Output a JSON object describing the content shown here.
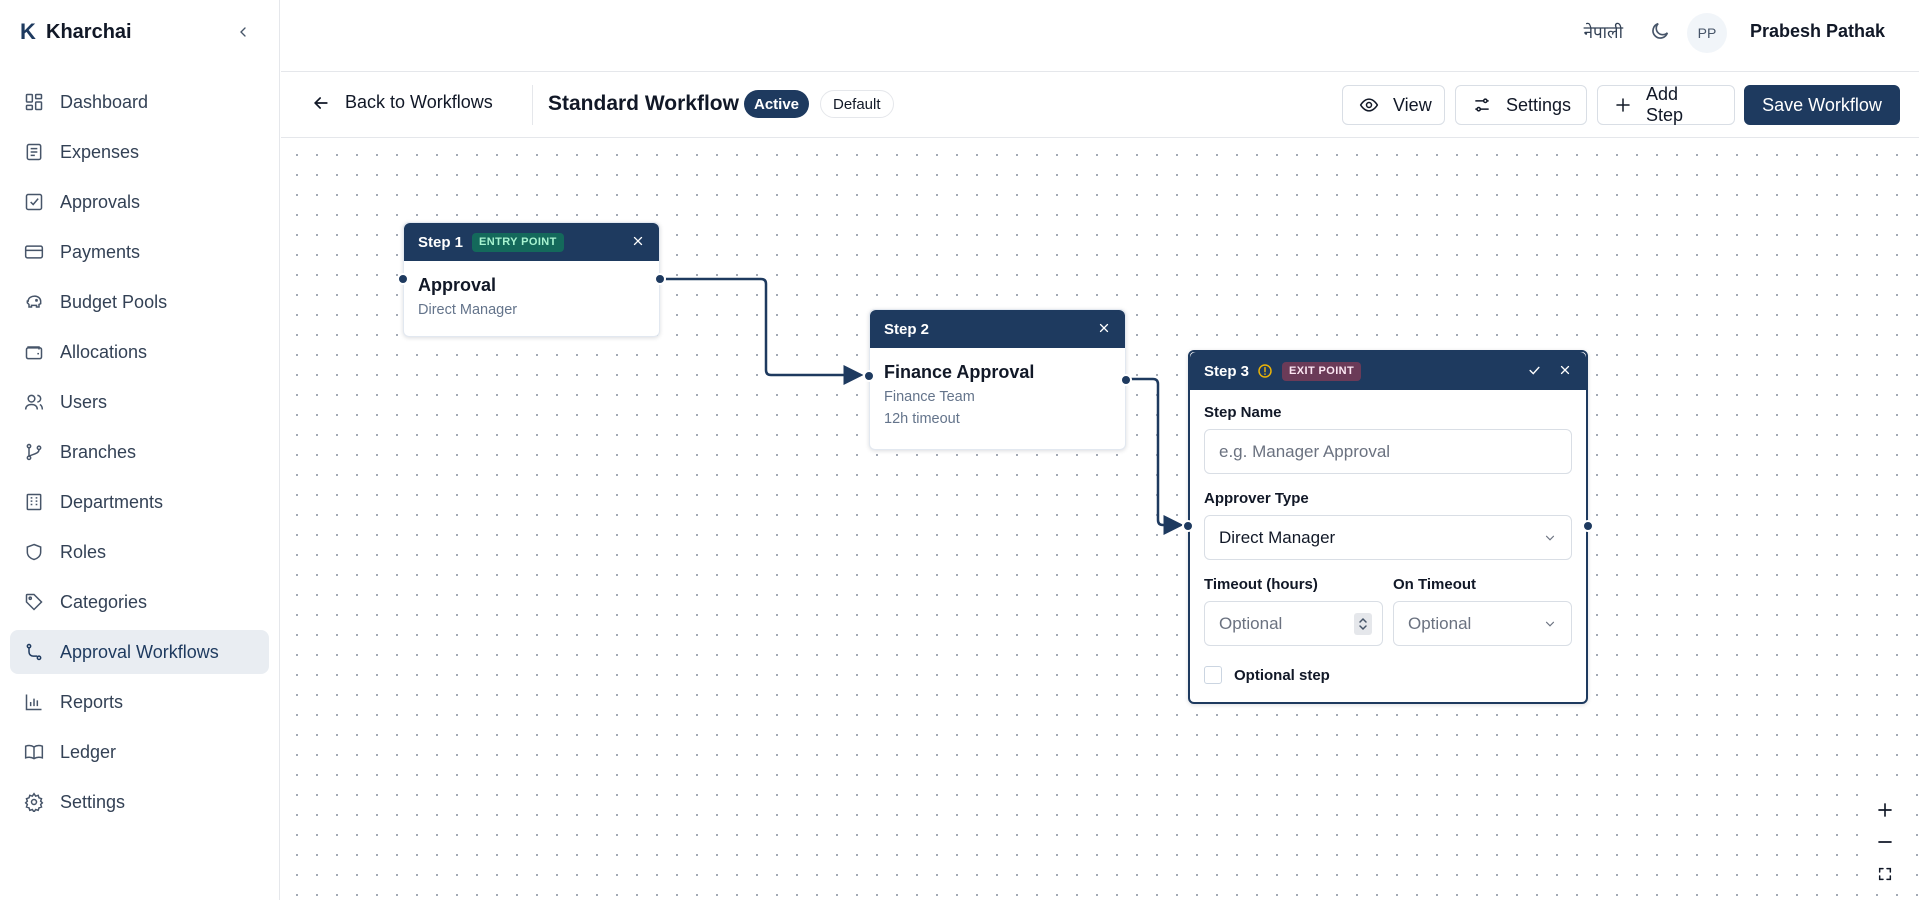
{
  "app": {
    "logo_letter": "K",
    "name": "Kharchai"
  },
  "sidebar": {
    "items": [
      {
        "label": "Dashboard",
        "icon": "dashboard-icon"
      },
      {
        "label": "Expenses",
        "icon": "receipt-icon"
      },
      {
        "label": "Approvals",
        "icon": "checkbox-icon"
      },
      {
        "label": "Payments",
        "icon": "credit-card-icon"
      },
      {
        "label": "Budget Pools",
        "icon": "piggy-bank-icon"
      },
      {
        "label": "Allocations",
        "icon": "wallet-icon"
      },
      {
        "label": "Users",
        "icon": "users-icon"
      },
      {
        "label": "Branches",
        "icon": "git-branch-icon"
      },
      {
        "label": "Departments",
        "icon": "building-icon"
      },
      {
        "label": "Roles",
        "icon": "shield-icon"
      },
      {
        "label": "Categories",
        "icon": "tag-icon"
      },
      {
        "label": "Approval Workflows",
        "icon": "workflow-icon",
        "active": true
      },
      {
        "label": "Reports",
        "icon": "bar-chart-icon"
      },
      {
        "label": "Ledger",
        "icon": "book-icon"
      },
      {
        "label": "Settings",
        "icon": "gear-icon"
      }
    ]
  },
  "header": {
    "language": "नेपाली",
    "avatar_initials": "PP",
    "user_name": "Prabesh Pathak"
  },
  "toolbar": {
    "back_label": "Back to Workflows",
    "workflow_title": "Standard Workflow",
    "status_badge": "Active",
    "default_badge": "Default",
    "view_label": "View",
    "settings_label": "Settings",
    "add_step_label": "Add Step",
    "save_label": "Save Workflow"
  },
  "steps": [
    {
      "header": "Step 1",
      "tag": "ENTRY POINT",
      "title": "Approval",
      "approver": "Direct Manager"
    },
    {
      "header": "Step 2",
      "title": "Finance Approval",
      "approver": "Finance Team",
      "timeout": "12h timeout"
    },
    {
      "header": "Step 3",
      "tag": "EXIT POINT",
      "form": {
        "step_name_label": "Step Name",
        "step_name_placeholder": "e.g. Manager Approval",
        "approver_type_label": "Approver Type",
        "approver_type_value": "Direct Manager",
        "timeout_label": "Timeout (hours)",
        "timeout_placeholder": "Optional",
        "on_timeout_label": "On Timeout",
        "on_timeout_value": "Optional",
        "optional_step_label": "Optional step"
      }
    }
  ],
  "colors": {
    "primary": "#1e3a5f",
    "entry_tag": "#14695b",
    "exit_tag": "#6b3b58",
    "warning": "#eab308"
  }
}
